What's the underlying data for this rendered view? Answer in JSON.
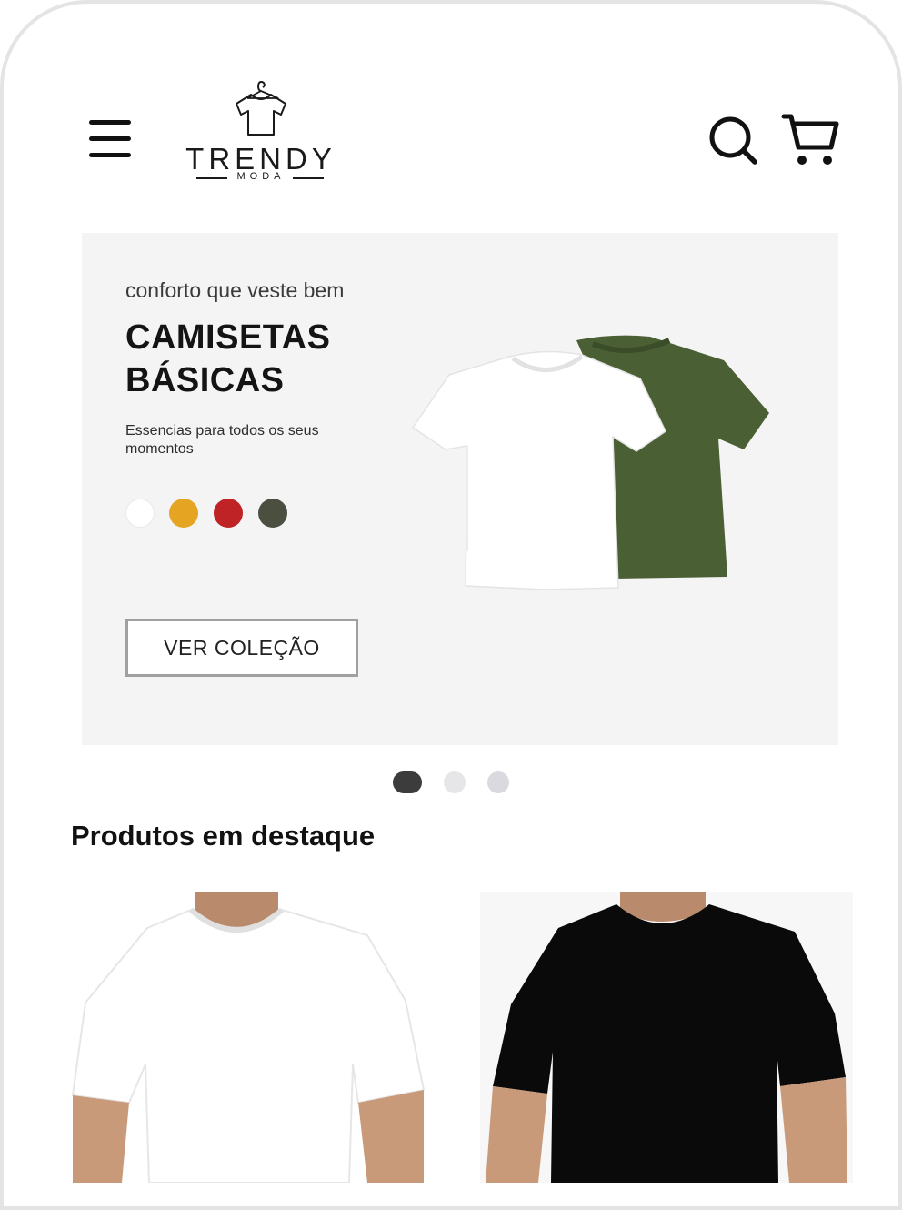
{
  "header": {
    "logo_word": "TRENDY",
    "logo_sub": "MODA"
  },
  "hero": {
    "tagline": "conforto que veste bem",
    "title_line1": "CAMISETAS",
    "title_line2": "BÁSICAS",
    "description": "Essencias para todos os seus momentos",
    "swatches": [
      "#ffffff",
      "#e5a422",
      "#c02326",
      "#4a4f40"
    ],
    "cta_label": "VER COLEÇÃO"
  },
  "carousel": {
    "active_index": 0,
    "total": 3
  },
  "featured": {
    "title": "Produtos em destaque",
    "products": [
      {
        "color": "white"
      },
      {
        "color": "black"
      }
    ]
  },
  "colors": {
    "hero_bg": "#f4f4f4",
    "shirt_green": "#4a5f34",
    "dot_active": "#3c3c3c",
    "dot_inactive": "#e6e6e8"
  }
}
